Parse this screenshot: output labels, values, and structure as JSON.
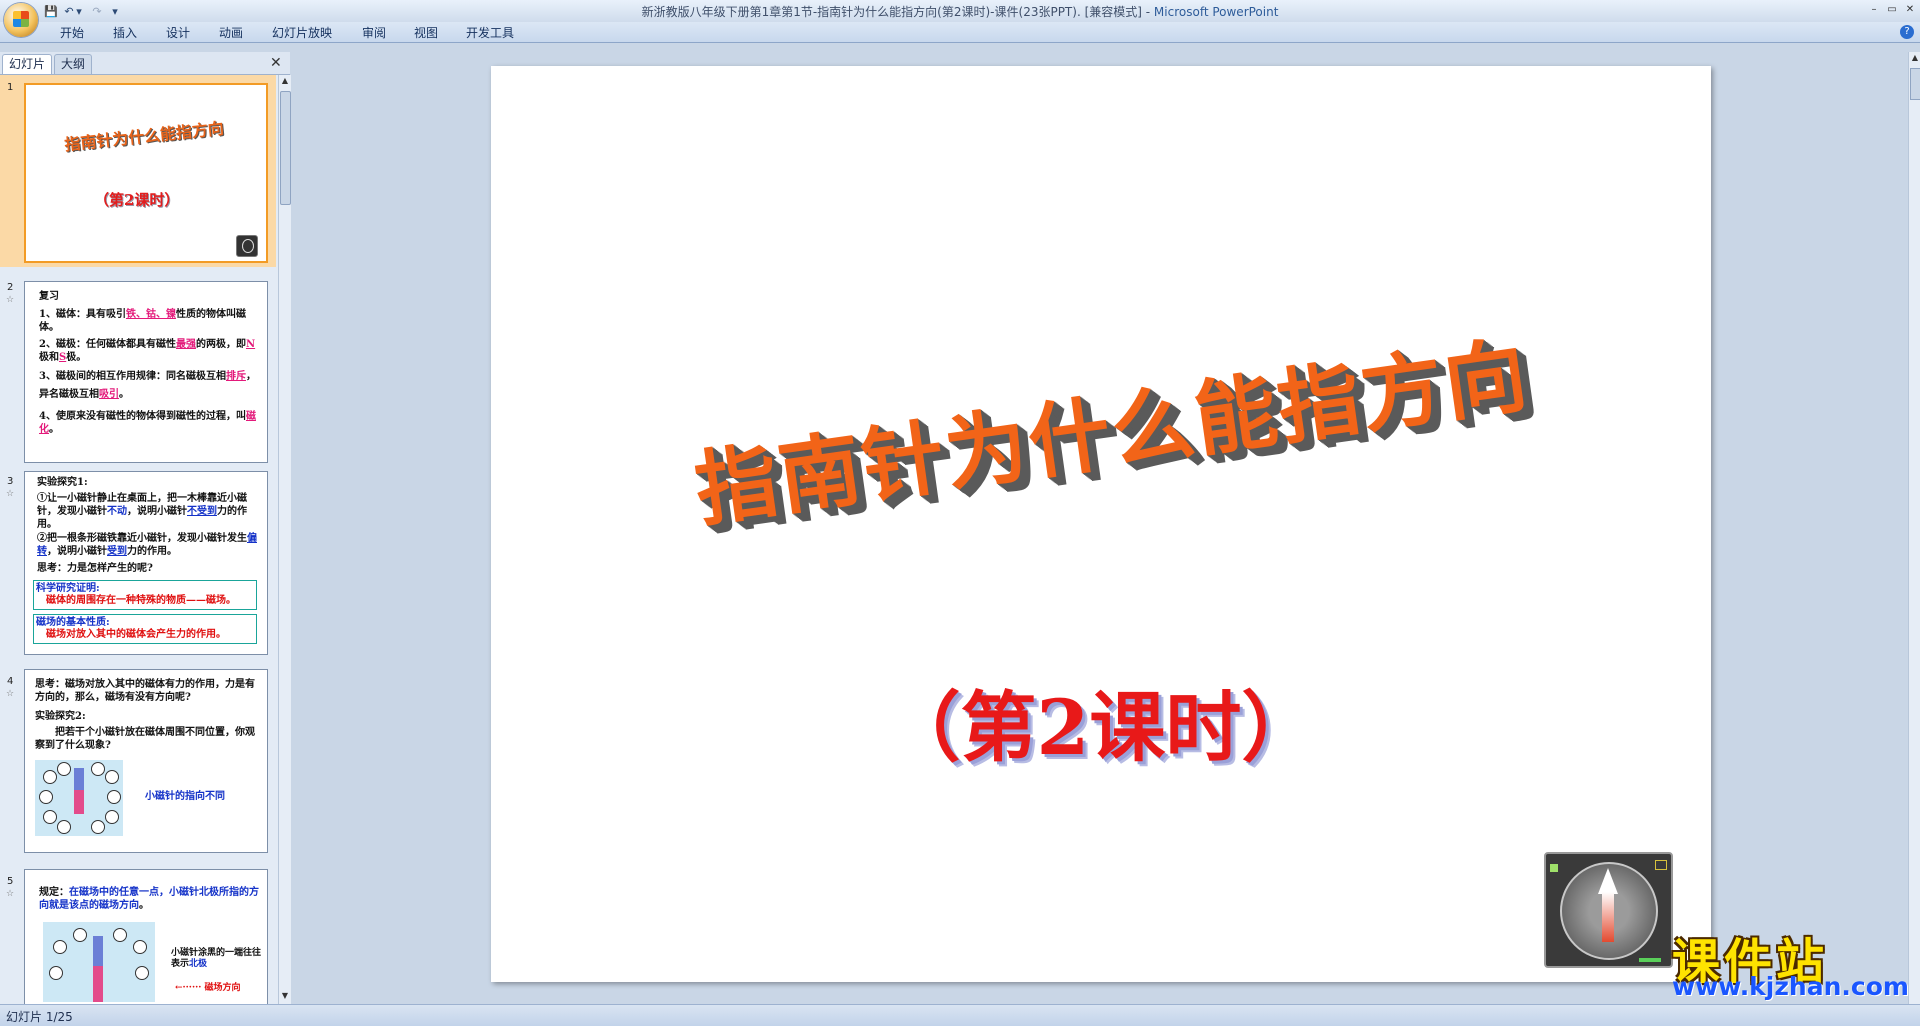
{
  "window": {
    "title": "新浙教版八年级下册第1章第1节-指南针为什么能指方向(第2课时)-课件(23张PPT). [兼容模式]",
    "app_name": "Microsoft PowerPoint",
    "minimize": "–",
    "maximize": "▭",
    "close": "✕"
  },
  "qat": {
    "save": "💾",
    "undo": "↶",
    "undo_arrow": "▾",
    "redo": "↷",
    "customize": "▾"
  },
  "ribbon": {
    "tabs": [
      "开始",
      "插入",
      "设计",
      "动画",
      "幻灯片放映",
      "审阅",
      "视图",
      "开发工具"
    ],
    "help": "?"
  },
  "left_panel": {
    "tabs": {
      "slides": "幻灯片",
      "outline": "大纲"
    },
    "close": "✕"
  },
  "thumbnails": [
    {
      "num": "1",
      "title": "指南针为什么能指方向",
      "subtitle": "（第2课时）"
    },
    {
      "num": "2",
      "heading": "复习",
      "l1a": "1、磁体：具有吸引",
      "l1b": "铁、钴、镍",
      "l1c": "性质的物体叫磁体。",
      "l2a": "2、磁极：任何磁体都具有磁性",
      "l2b": "最强",
      "l2c": "的两极，即",
      "l2d": "N",
      "l2e": "极和",
      "l2f": "S",
      "l2g": "极。",
      "l3a": "3、磁极间的相互作用规律：同名磁极互相",
      "l3b": "排斥",
      "l3c": "，异名磁极互相",
      "l3d": "吸引",
      "l3e": "。",
      "l4a": "4、使原来没有磁性的物体得到磁性的过程，叫",
      "l4b": "磁化",
      "l4c": "。"
    },
    {
      "num": "3",
      "heading": "实验探究1:",
      "p1a": "①让一小磁针静止在桌面上，把一木棒靠近小磁针，发现小磁针",
      "p1b": "不动",
      "p1c": "，说明小磁针",
      "p1d": "不受到",
      "p1e": "力的作用。",
      "p2a": "②把一根条形磁铁靠近小磁针，发现小磁针发生",
      "p2b": "偏转",
      "p2c": "，说明小磁针",
      "p2d": "受到",
      "p2e": "力的作用。",
      "think": "思考：力是怎样产生的呢?",
      "box1_title": "科学研究证明:",
      "box1_text": "磁体的周围存在一种特殊的物质——磁场。",
      "box2_title": "磁场的基本性质:",
      "box2_text": "磁场对放入其中的磁体会产生力的作用。"
    },
    {
      "num": "4",
      "think": "思考：磁场对放入其中的磁体有力的作用，力是有方向的，那么，磁场有没有方向呢?",
      "heading": "实验探究2:",
      "body": "把若干个小磁针放在磁体周围不同位置，你观察到了什么现象?",
      "caption": "小磁针的指向不同"
    },
    {
      "num": "5",
      "rule_a": "规定：",
      "rule_b": "在磁场中的任意一点，小磁针北极所指的方向就是该点的磁场方向",
      "rule_c": "。",
      "note_a": "小磁针涂黑的一端往往表示",
      "note_b": "北极",
      "arrow_label": "磁场方向"
    }
  ],
  "slide": {
    "title": "指南针为什么能指方向",
    "subtitle": "（第2课时）"
  },
  "watermark": {
    "main": "课件站",
    "url": "www.kjzhan.com"
  },
  "status": {
    "slide_indicator": "幻灯片 1/25"
  },
  "colors": {
    "title_orange": "#f26418",
    "subtitle_red": "#e81919",
    "selected_thumb": "#fbd9a6"
  }
}
